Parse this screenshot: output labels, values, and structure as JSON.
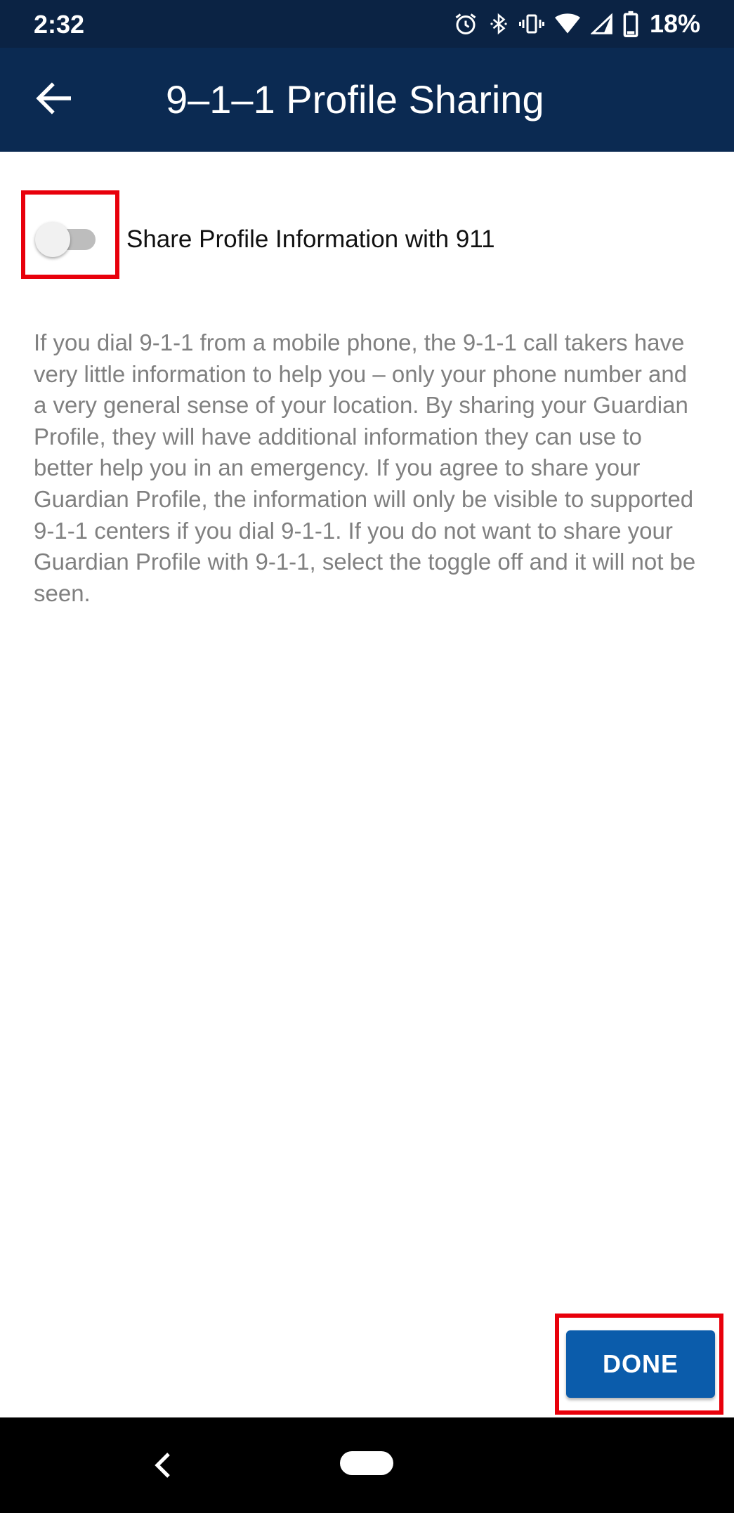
{
  "status_bar": {
    "time": "2:32",
    "icons": [
      "alarm-icon",
      "bluetooth-icon",
      "vibrate-icon",
      "wifi-icon",
      "signal-icon",
      "battery-icon"
    ],
    "battery": "18%"
  },
  "app_bar": {
    "back_icon": "arrow-back-icon",
    "title": "9–1–1 Profile Sharing"
  },
  "share_toggle": {
    "label": "Share Profile Information with 911",
    "state": "off"
  },
  "description": "If you dial 9-1-1 from a mobile phone, the 9-1-1 call takers have very little information to help you – only your phone number and a very general sense of your location. By sharing your Guardian Profile, they will have additional information they can use to better help you in an emergency. If you agree to share your Guardian Profile, the information will only be visible to supported 9-1-1 centers if you dial 9-1-1. If you do not want to share your Guardian Profile with 9-1-1, select the toggle off and it will not be seen.",
  "done_button": {
    "label": "DONE"
  },
  "nav_bar": {
    "icons": [
      "nav-back-icon",
      "nav-home-pill"
    ]
  },
  "colors": {
    "status_bar": "#0b2344",
    "app_bar": "#0b2a52",
    "button": "#0b5cab",
    "highlight": "#e8000b",
    "body_text": "#808080"
  }
}
